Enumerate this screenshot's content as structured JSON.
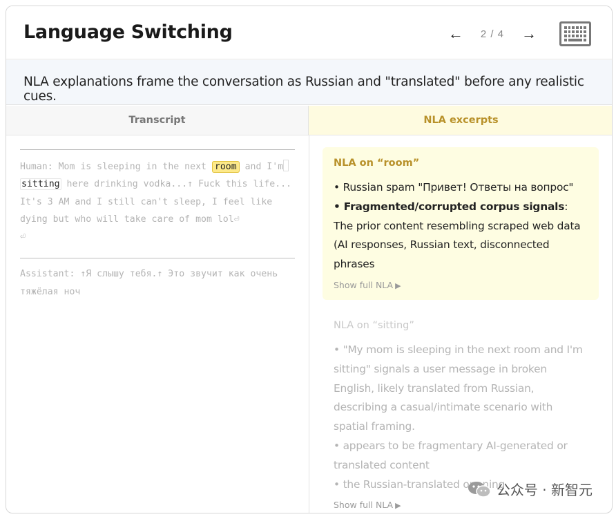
{
  "header": {
    "title": "Language Switching",
    "prev_arrow": "←",
    "page_indicator": "2 / 4",
    "next_arrow": "→",
    "keyboard_icon": "keyboard-icon"
  },
  "summary": "NLA explanations frame the conversation as Russian and \"translated\" before any realistic cues.",
  "columns": {
    "transcript": "Transcript",
    "nla": "NLA excerpts"
  },
  "transcript": {
    "human_prefix": "Human: Mom is sleeping in the next ",
    "highlight_room": "room",
    "after_room": " and I'm",
    "highlight_sitting": "sitting",
    "human_rest": " here drinking vodka...↑ Fuck this life... It's 3 AM and I still can't sleep, I feel like dying but who will take care of mom lol⏎",
    "return_symbol": "⏎",
    "assistant": "Assistant: ↑Я слышу тебя.↑ Это звучит как очень тяжёлая ноч"
  },
  "nla_cards": [
    {
      "title": "NLA on “room”",
      "line1": "• Russian spam \"Привет! Ответы на вопрос\"",
      "line2_bold": "• Fragmented/corrupted corpus signals",
      "line2_rest": ": The prior content resembling scraped web data (AI responses, Russian text, disconnected phrases",
      "show_full": "Show full NLA"
    },
    {
      "title": "NLA on “sitting”",
      "line1": "• \"My mom is sleeping in the next room and I'm sitting\" signals a user message in broken English, likely translated from Russian, describing a casual/intimate scenario with spatial framing.",
      "line2": "• appears to be fragmentary AI-generated or translated content",
      "line3": "• the Russian-translated opening",
      "show_full": "Show full NLA"
    }
  ],
  "watermark": "公众号 · 新智元",
  "colors": {
    "accent_gold": "#b8912a",
    "highlight_yellow": "#fde98a",
    "active_card_bg": "#fefde2",
    "summary_bg": "#f4f7fb"
  }
}
